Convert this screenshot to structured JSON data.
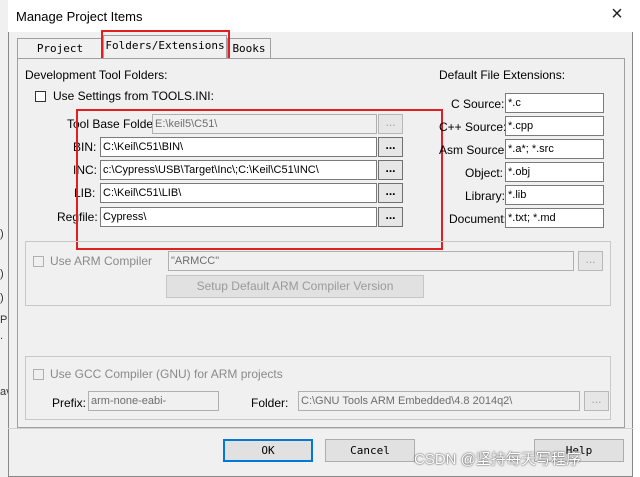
{
  "window": {
    "title": "Manage Project Items",
    "close_glyph": "×"
  },
  "background_fragments": [
    ")",
    ")",
    ")",
    "P",
    ".",
    "av"
  ],
  "tabs": [
    {
      "label": "Project Items"
    },
    {
      "label": "Folders/Extensions"
    },
    {
      "label": "Books"
    }
  ],
  "dev_tools": {
    "heading": "Development Tool Folders:",
    "use_settings_label": "Use Settings from TOOLS.INI:",
    "use_settings_checked": false,
    "rows": [
      {
        "label": "Tool Base Folder:",
        "value": "E:\\keil5\\C51\\",
        "readonly": true
      },
      {
        "label": "BIN:",
        "value": "C:\\Keil\\C51\\BIN\\",
        "readonly": false
      },
      {
        "label": "INC:",
        "value": "c:\\Cypress\\USB\\Target\\Inc\\;C:\\Keil\\C51\\INC\\",
        "readonly": false
      },
      {
        "label": "LIB:",
        "value": "C:\\Keil\\C51\\LIB\\",
        "readonly": false
      },
      {
        "label": "Regfile:",
        "value": "Cypress\\",
        "readonly": false
      }
    ],
    "browse_label": "..."
  },
  "extensions": {
    "heading": "Default File Extensions:",
    "rows": [
      {
        "label": "C Source:",
        "value": "*.c"
      },
      {
        "label": "C++ Source:",
        "value": "*.cpp"
      },
      {
        "label": "Asm Source:",
        "value": "*.a*; *.src"
      },
      {
        "label": "Object:",
        "value": "*.obj"
      },
      {
        "label": "Library:",
        "value": "*.lib"
      },
      {
        "label": "Document:",
        "value": "*.txt; *.md"
      }
    ]
  },
  "arm": {
    "use_label": "Use ARM Compiler",
    "value": "\"ARMCC\"",
    "setup_label": "Setup Default ARM Compiler Version"
  },
  "gcc": {
    "use_label": "Use GCC Compiler (GNU) for ARM projects",
    "prefix_label": "Prefix:",
    "prefix_value": "arm-none-eabi-",
    "folder_label": "Folder:",
    "folder_value": "C:\\GNU Tools ARM Embedded\\4.8 2014q2\\"
  },
  "buttons": {
    "ok": "OK",
    "cancel": "Cancel",
    "help": "Help"
  },
  "watermark": "CSDN @坚持每天写程序",
  "colors": {
    "highlight": "#e02020",
    "default_button_border": "#0078d7",
    "dialog_bg": "#f0f0f0"
  }
}
